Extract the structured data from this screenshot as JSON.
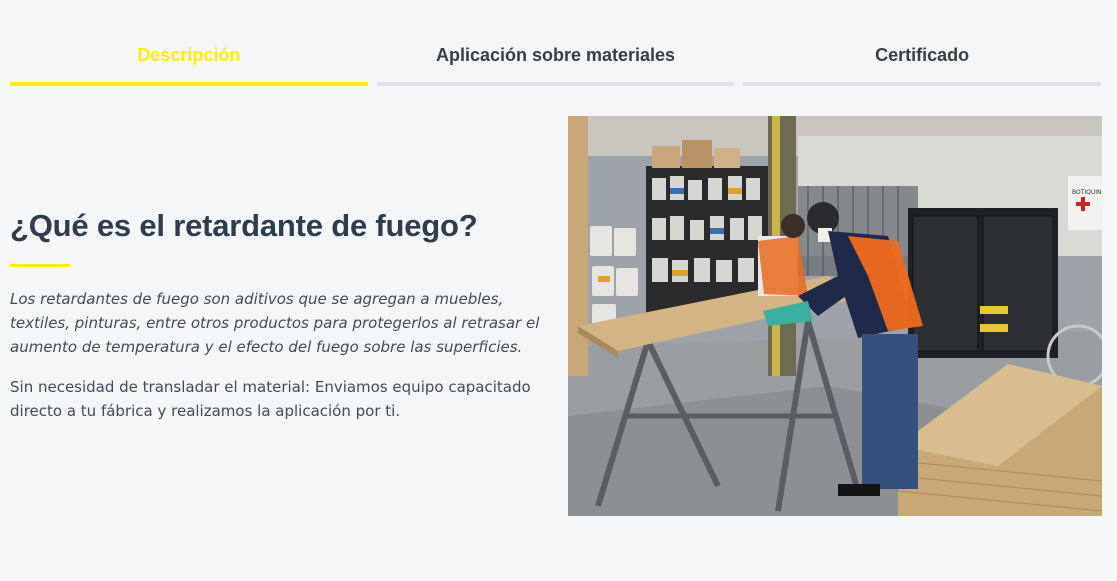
{
  "tabs": [
    {
      "label": "Descripción",
      "active": true
    },
    {
      "label": "Aplicación sobre materiales",
      "active": false
    },
    {
      "label": "Certificado",
      "active": false
    }
  ],
  "content": {
    "heading": "¿Qué es el retardante de fuego?",
    "paragraph_italic": "Los retardantes de fuego son aditivos que se agregan a muebles, textiles, pinturas, entre otros productos para protegerlos al retrasar el aumento de temperatura y el efecto del fuego sobre las superficies.",
    "paragraph": "Sin necesidad de transladar el material: Enviamos equipo capacitado directo a tu fábrica y realizamos la aplicación por ti.",
    "cabinet_sign": "BOTIQUIN"
  },
  "colors": {
    "accent": "#ffee00",
    "heading": "#2f3c4b",
    "text": "#454c55",
    "tab_inactive_line": "#dfe1e4",
    "background": "#f4f6f8"
  }
}
